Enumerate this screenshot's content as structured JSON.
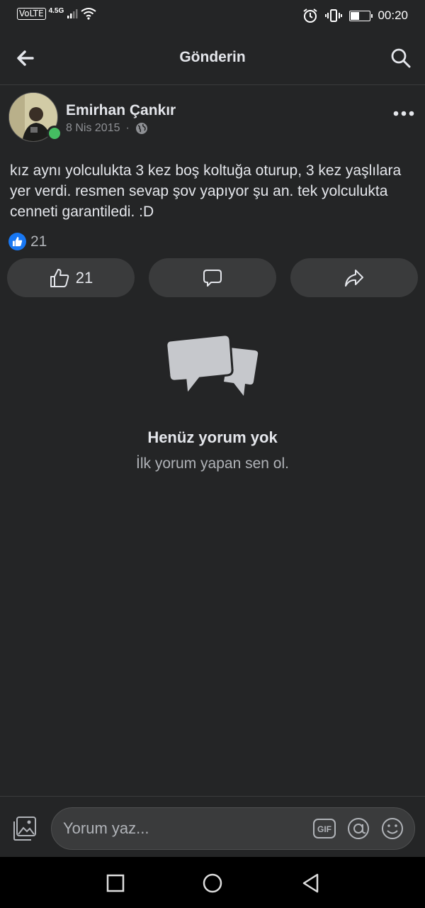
{
  "status_bar": {
    "volte": "VoLTE",
    "network": "4.5G",
    "battery": "41",
    "battery_level": 0.41,
    "time": "00:20"
  },
  "header": {
    "title": "Gönderin",
    "back_icon": "arrow-left-icon",
    "search_icon": "search-icon"
  },
  "post": {
    "author": "Emirhan Çankır",
    "date": "8 Nis 2015",
    "separator": "·",
    "privacy_icon": "globe-icon",
    "online": true,
    "text": "kız aynı yolculukta 3 kez boş koltuğa oturup, 3 kez yaşlılara yer verdi. resmen sevap şov yapıyor şu an. tek yolculukta cenneti garantiledi. :D",
    "reaction_count": "21"
  },
  "actions": {
    "like_count": "21",
    "like_icon": "thumbs-up-icon",
    "comment_icon": "comment-bubble-icon",
    "share_icon": "share-arrow-icon"
  },
  "empty_state": {
    "title": "Henüz yorum yok",
    "subtitle": "İlk yorum yapan sen ol."
  },
  "composer": {
    "placeholder": "Yorum yaz...",
    "gif_label": "GIF"
  },
  "colors": {
    "background": "#242526",
    "surface": "#3a3b3c",
    "accent": "#1877f2",
    "online": "#45bd62"
  }
}
